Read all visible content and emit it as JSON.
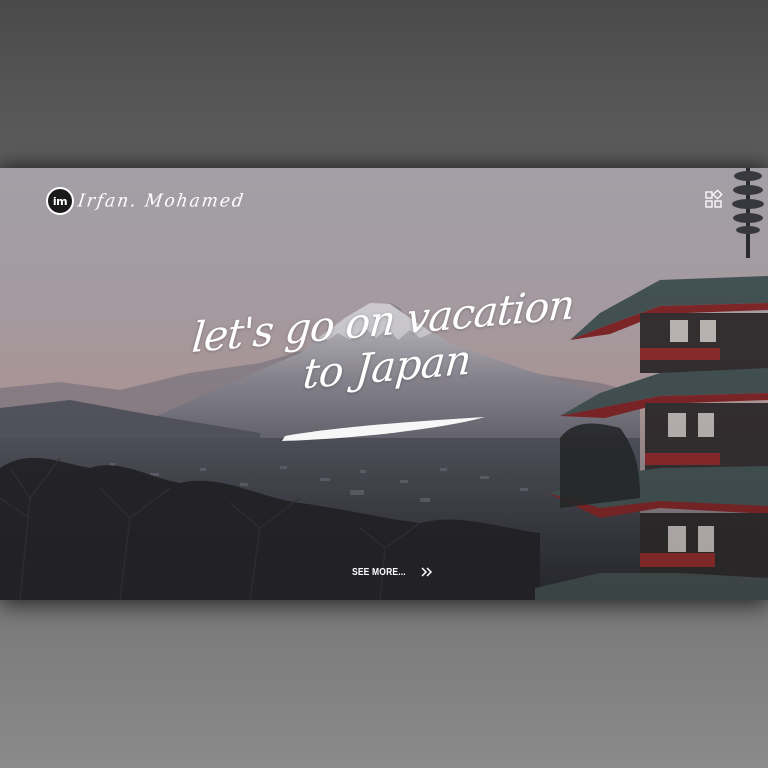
{
  "header": {
    "logo_badge_text": "im",
    "logo_name": "Irfan. Mohamed",
    "menu_icon": "grid-apps-icon"
  },
  "hero": {
    "headline_line1": "let's go on vacation",
    "headline_line2": "to Japan",
    "cta_label": "SEE MORE...",
    "cta_icon": "double-chevron-right-icon"
  },
  "colors": {
    "text": "#ffffff",
    "pagoda_red": "#8c2a2c",
    "sky_top": "#b3b0b6",
    "sky_glow": "#c8a9aa"
  }
}
